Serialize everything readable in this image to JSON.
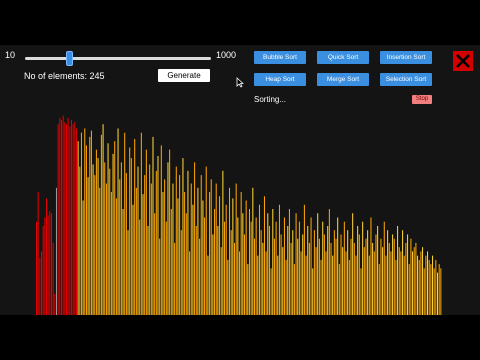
{
  "slider": {
    "min_label": "10",
    "max_label": "1000",
    "value": 245,
    "min": 10,
    "max": 1000
  },
  "elements_label": "No of elements: 245",
  "generate_label": "Generate",
  "algorithms": [
    {
      "label": "Bubble Sort"
    },
    {
      "label": "Quick Sort"
    },
    {
      "label": "Insertion Sort"
    },
    {
      "label": "Heap Sort"
    },
    {
      "label": "Merge Sort"
    },
    {
      "label": "Selection Sort"
    }
  ],
  "status_text": "Sorting...",
  "stop_label": "Stop",
  "icons": {
    "close": "close-x-icon",
    "cursor": "mouse-pointer-icon"
  },
  "colors": {
    "sorted": "#e60000",
    "unsorted_a": "#ffa500",
    "unsorted_b": "#ffd633",
    "compare": "#9a9a9a",
    "button": "#3b8fe0",
    "close": "#d40000"
  },
  "array": {
    "sorted_count": 25,
    "comparing_index": 12,
    "values": [
      0.44,
      0.58,
      0.27,
      0.3,
      0.42,
      0.46,
      0.55,
      0.47,
      0.49,
      0.48,
      0.34,
      0.1,
      0.6,
      0.9,
      0.93,
      0.92,
      0.94,
      0.91,
      0.9,
      0.93,
      0.89,
      0.92,
      0.9,
      0.91,
      0.88,
      0.82,
      0.7,
      0.86,
      0.54,
      0.88,
      0.8,
      0.65,
      0.84,
      0.87,
      0.71,
      0.66,
      0.78,
      0.74,
      0.6,
      0.85,
      0.9,
      0.72,
      0.62,
      0.81,
      0.69,
      0.58,
      0.76,
      0.82,
      0.55,
      0.88,
      0.64,
      0.72,
      0.5,
      0.86,
      0.67,
      0.4,
      0.79,
      0.74,
      0.52,
      0.83,
      0.6,
      0.7,
      0.45,
      0.86,
      0.57,
      0.66,
      0.78,
      0.42,
      0.71,
      0.62,
      0.84,
      0.48,
      0.68,
      0.75,
      0.36,
      0.8,
      0.58,
      0.64,
      0.44,
      0.72,
      0.78,
      0.5,
      0.62,
      0.34,
      0.7,
      0.55,
      0.66,
      0.4,
      0.74,
      0.58,
      0.48,
      0.68,
      0.3,
      0.62,
      0.52,
      0.72,
      0.42,
      0.6,
      0.36,
      0.66,
      0.54,
      0.46,
      0.7,
      0.28,
      0.58,
      0.64,
      0.38,
      0.5,
      0.62,
      0.42,
      0.56,
      0.32,
      0.68,
      0.44,
      0.52,
      0.26,
      0.6,
      0.4,
      0.55,
      0.34,
      0.62,
      0.46,
      0.3,
      0.58,
      0.48,
      0.38,
      0.54,
      0.24,
      0.5,
      0.44,
      0.6,
      0.36,
      0.46,
      0.28,
      0.52,
      0.4,
      0.34,
      0.56,
      0.3,
      0.48,
      0.42,
      0.22,
      0.5,
      0.36,
      0.44,
      0.28,
      0.52,
      0.38,
      0.32,
      0.46,
      0.26,
      0.42,
      0.5,
      0.34,
      0.4,
      0.24,
      0.48,
      0.36,
      0.44,
      0.3,
      0.38,
      0.52,
      0.28,
      0.42,
      0.34,
      0.46,
      0.22,
      0.4,
      0.32,
      0.48,
      0.36,
      0.26,
      0.44,
      0.38,
      0.3,
      0.42,
      0.5,
      0.34,
      0.28,
      0.4,
      0.36,
      0.46,
      0.24,
      0.38,
      0.32,
      0.44,
      0.3,
      0.4,
      0.26,
      0.36,
      0.48,
      0.34,
      0.28,
      0.42,
      0.38,
      0.22,
      0.44,
      0.32,
      0.36,
      0.4,
      0.28,
      0.46,
      0.34,
      0.3,
      0.38,
      0.42,
      0.24,
      0.36,
      0.32,
      0.44,
      0.28,
      0.4,
      0.34,
      0.3,
      0.38,
      0.36,
      0.26,
      0.42,
      0.32,
      0.3,
      0.4,
      0.28,
      0.34,
      0.38,
      0.24,
      0.36,
      0.3,
      0.32,
      0.34,
      0.28,
      0.26,
      0.3,
      0.32,
      0.22,
      0.28,
      0.3,
      0.26,
      0.24,
      0.28,
      0.22,
      0.26,
      0.2,
      0.24,
      0.22
    ]
  }
}
